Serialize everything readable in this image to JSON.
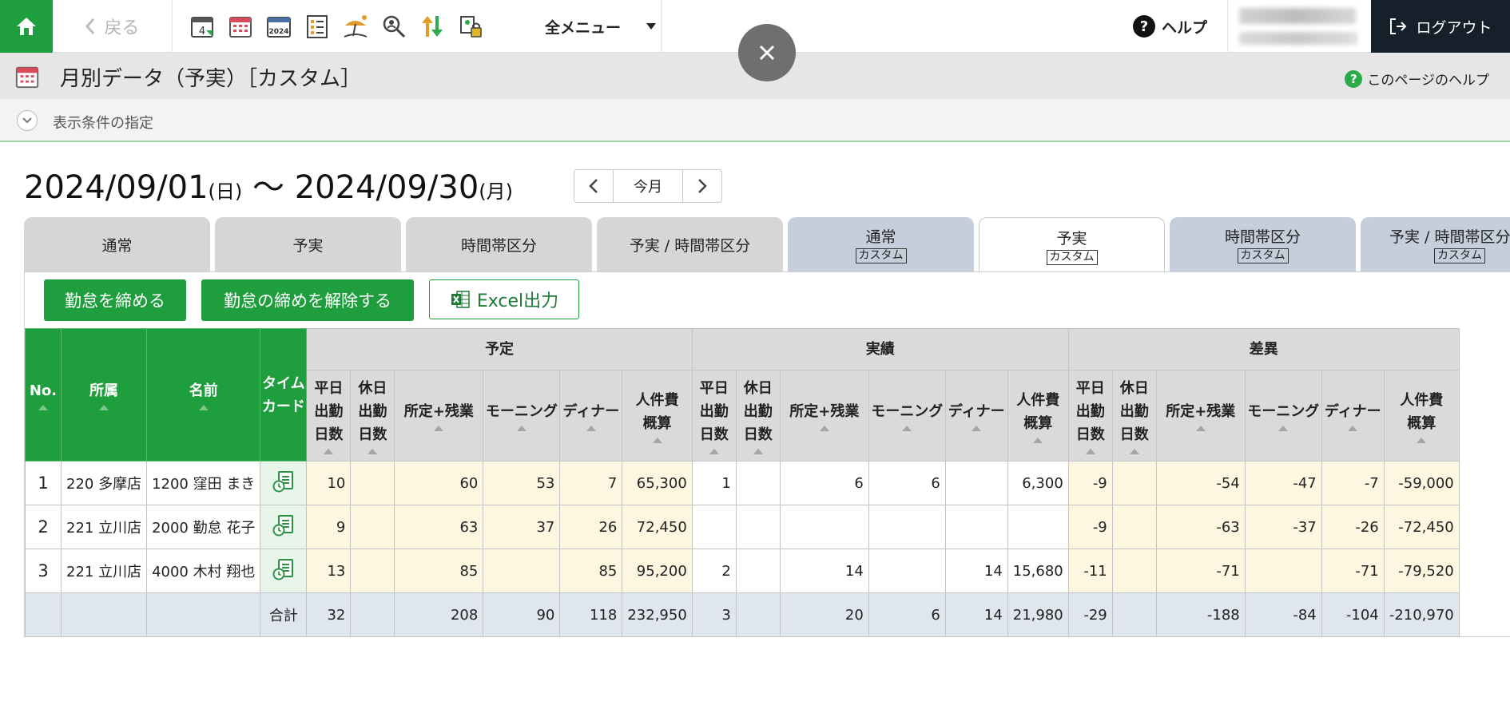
{
  "topbar": {
    "back_label": "戻る",
    "nav_icons": [
      "calendar-4-icon",
      "calendar-grid-icon",
      "calendar-2024-icon",
      "checklist-icon",
      "vacation-icon",
      "search-person-icon",
      "sort-arrows-icon",
      "user-lock-icon"
    ],
    "calendar_day": "4",
    "calendar_year": "2024",
    "all_menu_label": "全メニュー",
    "help_label": "ヘルプ",
    "logout_label": "ログアウト"
  },
  "title": {
    "page_title": "月別データ（予実）［カスタム］",
    "page_help_label": "このページのヘルプ"
  },
  "conditions": {
    "label": "表示条件の指定"
  },
  "date_range": {
    "start_date": "2024/09/01",
    "start_dow": "(日)",
    "separator": "〜",
    "end_date": "2024/09/30",
    "end_dow": "(月)",
    "today_label": "今月"
  },
  "tabs": [
    {
      "label": "通常",
      "badge": ""
    },
    {
      "label": "予実",
      "badge": ""
    },
    {
      "label": "時間帯区分",
      "badge": ""
    },
    {
      "label": "予実 / 時間帯区分",
      "badge": ""
    },
    {
      "label": "通常",
      "badge": "カスタム"
    },
    {
      "label": "予実",
      "badge": "カスタム"
    },
    {
      "label": "時間帯区分",
      "badge": "カスタム"
    },
    {
      "label": "予実 / 時間帯区分",
      "badge": "カスタム"
    }
  ],
  "actions": {
    "close_label": "勤怠を締める",
    "unclose_label": "勤怠の締めを解除する",
    "excel_label": "Excel出力"
  },
  "table": {
    "headers": {
      "no": "No.",
      "dept": "所属",
      "name": "名前",
      "timecard": "タイム\nカード",
      "group_plan": "予定",
      "group_actual": "実績",
      "group_diff": "差異",
      "weekday_days": "平日\n出勤\n日数",
      "holiday_days": "休日\n出勤\n日数",
      "regular_overtime": "所定+残業",
      "morning": "モーニング",
      "dinner": "ディナー",
      "labor_cost": "人件費\n概算"
    },
    "rows": [
      {
        "no": "1",
        "dept": "220 多摩店",
        "name": "1200 窪田 まき",
        "plan": [
          "10",
          "",
          "60",
          "53",
          "7",
          "65,300"
        ],
        "actual": [
          "1",
          "",
          "6",
          "6",
          "",
          "6,300"
        ],
        "diff": [
          "-9",
          "",
          "-54",
          "-47",
          "-7",
          "-59,000"
        ]
      },
      {
        "no": "2",
        "dept": "221 立川店",
        "name": "2000 勤怠 花子",
        "plan": [
          "9",
          "",
          "63",
          "37",
          "26",
          "72,450"
        ],
        "actual": [
          "",
          "",
          "",
          "",
          "",
          ""
        ],
        "diff": [
          "-9",
          "",
          "-63",
          "-37",
          "-26",
          "-72,450"
        ]
      },
      {
        "no": "3",
        "dept": "221 立川店",
        "name": "4000 木村 翔也",
        "plan": [
          "13",
          "",
          "85",
          "",
          "85",
          "95,200"
        ],
        "actual": [
          "2",
          "",
          "14",
          "",
          "14",
          "15,680"
        ],
        "diff": [
          "-11",
          "",
          "-71",
          "",
          "-71",
          "-79,520"
        ]
      }
    ],
    "total": {
      "label": "合計",
      "plan": [
        "32",
        "",
        "208",
        "90",
        "118",
        "232,950"
      ],
      "actual": [
        "3",
        "",
        "20",
        "6",
        "14",
        "21,980"
      ],
      "diff": [
        "-29",
        "",
        "-188",
        "-84",
        "-104",
        "-210,970"
      ]
    }
  },
  "colors": {
    "accent_green": "#1f9e3d",
    "logout_bg": "#16202a",
    "plan_cell_bg": "#fdf7e2",
    "total_row_bg": "#dfe6ee"
  }
}
